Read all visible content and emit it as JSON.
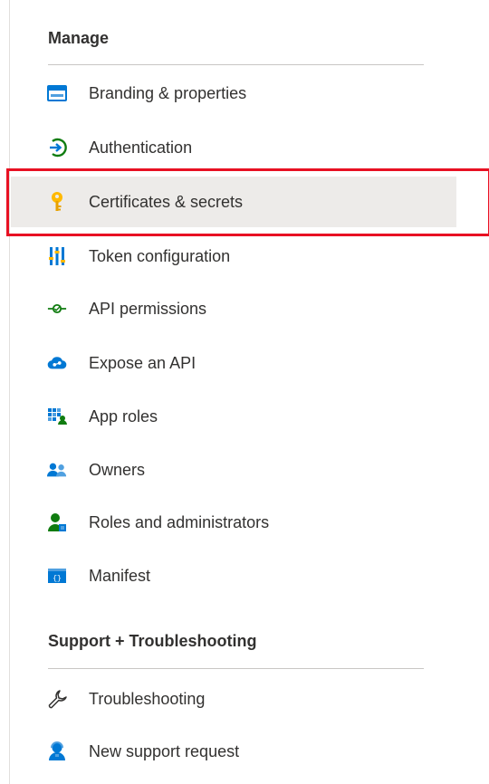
{
  "manage": {
    "header": "Manage",
    "items": [
      {
        "label": "Branding & properties",
        "icon": "branding-card-icon"
      },
      {
        "label": "Authentication",
        "icon": "authentication-arrow-icon"
      },
      {
        "label": "Certificates & secrets",
        "icon": "key-icon",
        "selected": true
      },
      {
        "label": "Token configuration",
        "icon": "token-bars-icon"
      },
      {
        "label": "API permissions",
        "icon": "api-permissions-icon"
      },
      {
        "label": "Expose an API",
        "icon": "cloud-icon"
      },
      {
        "label": "App roles",
        "icon": "app-roles-grid-icon"
      },
      {
        "label": "Owners",
        "icon": "owners-people-icon"
      },
      {
        "label": "Roles and administrators",
        "icon": "roles-admin-icon"
      },
      {
        "label": "Manifest",
        "icon": "manifest-icon"
      }
    ]
  },
  "support": {
    "header": "Support + Troubleshooting",
    "items": [
      {
        "label": "Troubleshooting",
        "icon": "wrench-icon"
      },
      {
        "label": "New support request",
        "icon": "support-person-icon"
      }
    ]
  },
  "colors": {
    "selected_bg": "#edebe9",
    "highlight_border": "#e81123",
    "accent_blue": "#0078d4",
    "accent_green": "#107c10",
    "key_yellow": "#ffb900"
  }
}
